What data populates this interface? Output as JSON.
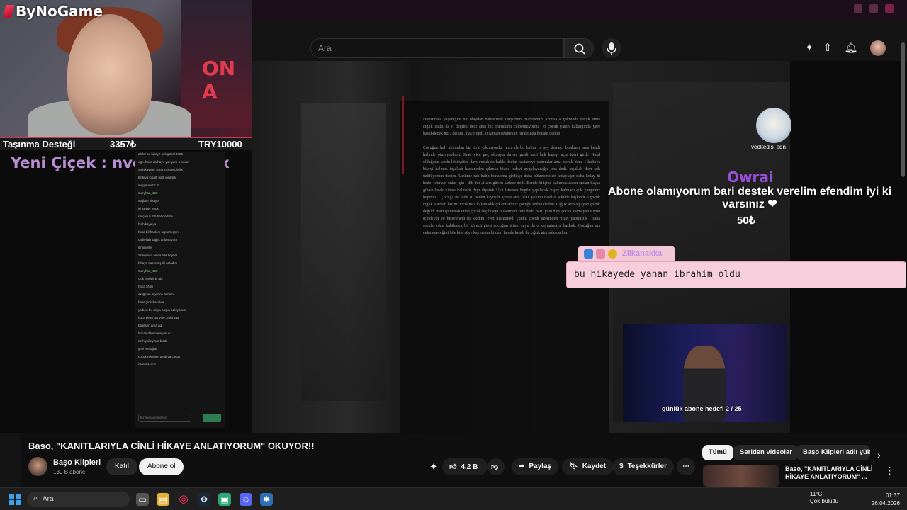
{
  "stream": {
    "brand": "ByNoGame",
    "poster_text": "ON A",
    "donation_bar": {
      "label": "Taşınma Desteği",
      "current": "3357₺",
      "goal": "TRY10000"
    },
    "new_follower": "Yeni Çiçek : nvoi_mitsbrex"
  },
  "search": {
    "placeholder": "Ara"
  },
  "chat": {
    "lines": [
      {
        "user": "",
        "text": "abiler bu hikaye çok güzel 3765"
      },
      {
        "user": "",
        "text": "ugh, hoca da hayır yok yom o budur"
      },
      {
        "user": "",
        "text": "ya hikayeler sonu için sevdiydik"
      },
      {
        "user": "",
        "text": "Erdeva kısaltı hadi insanlar"
      },
      {
        "user": "",
        "text": "mugimaxrr3: 3"
      },
      {
        "user": "meryhan_190",
        "text": ""
      },
      {
        "user": "",
        "text": "sağlam hikaye"
      },
      {
        "user": "",
        "text": "iyi şeyler hoca"
      },
      {
        "user": "",
        "text": "ne çocuk 2.5 bat cin filmi"
      },
      {
        "user": "",
        "text": "bu hikaye ya"
      },
      {
        "user": "",
        "text": "hoca bil hakkını saptamışsın"
      },
      {
        "user": "",
        "text": "cadiellah sağlık anlamazsın"
      },
      {
        "user": "",
        "text": "sinomelle"
      },
      {
        "user": "",
        "text": "Süleyman amca bilir heyser"
      },
      {
        "user": "",
        "text": "hikaye süpermiş iki anladım"
      },
      {
        "user": "meryhan_190",
        "text": ""
      },
      {
        "user": "",
        "text": "Çok faydalı bi abi"
      },
      {
        "user": "",
        "text": "hoca 3Nisi"
      },
      {
        "user": "",
        "text": "akliğimin ingilizce denemi"
      },
      {
        "user": "",
        "text": "hoca yine bozuldu"
      },
      {
        "user": "",
        "text": "ya ben bu olaya başka bakıyorum"
      },
      {
        "user": "",
        "text": "hoca peter ow yine 3Nisi yaa"
      },
      {
        "user": "",
        "text": "basitsen ama aq"
      },
      {
        "user": "",
        "text": "hocaa dayanamıyon aq"
      },
      {
        "user": "",
        "text": "ne hiyakeyimiz bizde"
      },
      {
        "user": "",
        "text": "yeni mesajlar"
      },
      {
        "user": "",
        "text": "çocuk nereden geldi ya çocuk"
      },
      {
        "user": "",
        "text": "nefesliasınız"
      }
    ],
    "input_placeholder": "Bir mesaj gönderin"
  },
  "overlay": {
    "sub_name": "veokedisi edn",
    "donor": "Owrai",
    "donation_message": "Abone olamıyorum bari destek verelim efendim iyi ki varsınız ❤",
    "donation_amount": "50₺",
    "tts_user": "Zilkanakka",
    "tts_message": "bu hikayede yanan ibrahim oldu",
    "sub_goal": "günlük abone hedefi 2 / 25"
  },
  "document": {
    "text": "Hayatımda yaşadığım bir olaydan bahsetmek istiyorum. Hafızamızı azımsa o çekmedi merak etme çığlık ataltı da o değildi dedi ama hiç merakımı celbetmiyordu , o çocuk yanın kalktığında yere basabilecek mi ? dedim , hayır dedi. o zaman üzülürsün hıraktında hocanı dedim\n\nÇocuğun hali aklımdan bir türlü çıkmıyordu, hoca da bu haline bi şey demeyi bırakmış ama kendi halinde oturuyordum. Saat iyice geç olmuştu dayım geldi hadi bak kapıyı açın içeri girdi. Nasıl olduğunu sordu kötüydüm dayı çocuk ne halde dedim hastaneye yatırdılar ama merak etme 1 haftaya bişeyi kalmaz inşallah hastaneden çıkınca bizde tedavi uygulayacağız ona dedi. inşallah dayı çok üzülüyorum dedim. Üzülme ruh halin bunalıma girdikçe daha bükmemeleri kolaylaşır daha kolay bi hedef olursun onlar için , dik dur allaha güven sadece dedi. Bende bi işine bakımda zaten ondan başka güvenilecek kimse kalmadı dayı diyerek Uyu istersen bugün yapılacak bişey kalmadı çok yorgunuz hepimiz . Çocuğa ne oldu su neden kaynadı içerde ateş falan yokmu nasıl o şekilde haşlandı o çocuk çığlık atarken biz mi vicdansız kalamadık çıkarmadınız çocuğu sudan dedim. Çığlık atıp ağlayan çocuk değildi markap merak etme çocuk hiç bişeyi hissetmedi bile dedi, nasıl yani dayı çocuk kaynayan suyun içindeydi ve hissetmedi mi dedim, evet hissetmedi çünkü çocuk üzerinden ritüel yapmıştık , sana sorular olan kabileden bir sürecü girdi çocuğun içine, suyu da o kaynatmaya başladı. Çocuğun acı çekmeyeceğini bile bile süye kaynarsın ki dayı hende kendi de çığlık atıyordu dedim."
  },
  "video": {
    "title": "Baso, \"KANITLARIYLA CİNLİ HİKAYE ANLATIYORUM\" OKUYOR!!",
    "channel": "Başo Klipleri",
    "subscribers": "130 B abone",
    "join_label": "Katıl",
    "subscribe_label": "Abone ol",
    "likes": "4,2 B",
    "share_label": "Paylaş",
    "save_label": "Kaydet",
    "thanks_label": "Teşekkürler"
  },
  "chips": [
    "Tümü",
    "Seriden videolar",
    "Başo Klipleri adlı yükl"
  ],
  "recommendation": {
    "title": "Baso, \"KANITLARIYLA CİNLİ HİKAYE ANLATIYORUM\" ..."
  },
  "taskbar": {
    "search": "Ara",
    "weather_temp": "11°C",
    "weather_desc": "Çok bulutlu",
    "time": "01:37",
    "date": "26.04.2026"
  },
  "colors": {
    "accent": "#c43a55",
    "donor": "#9a4fd8",
    "tts_bg": "#f7cfdc"
  }
}
